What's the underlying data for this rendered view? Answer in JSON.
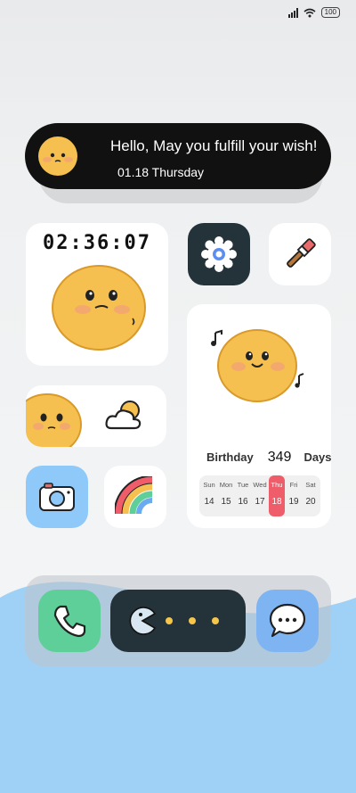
{
  "status_bar": {
    "battery": "100",
    "icons": [
      "signal-icon",
      "wifi-icon",
      "battery-icon"
    ]
  },
  "banner": {
    "greeting": "Hello, May you fulfill your wish!",
    "date": "01.18 Thursday"
  },
  "clock_widget": {
    "time": "02:36:07"
  },
  "app_icons": [
    "settings-icon",
    "paintbrush-icon",
    "camera-icon",
    "rainbow-icon",
    "cloud-sun-icon"
  ],
  "birthday_widget": {
    "label": "Birthday",
    "count": "349",
    "unit": "Days",
    "week": [
      {
        "day": "Sun",
        "date": "14"
      },
      {
        "day": "Mon",
        "date": "15"
      },
      {
        "day": "Tue",
        "date": "16"
      },
      {
        "day": "Wed",
        "date": "17"
      },
      {
        "day": "Thu",
        "date": "18"
      },
      {
        "day": "Fri",
        "date": "19"
      },
      {
        "day": "Sat",
        "date": "20"
      }
    ],
    "today_index": 4
  },
  "dock": {
    "apps": [
      "phone-icon",
      "pacman-widget",
      "message-icon"
    ]
  },
  "colors": {
    "accent_red": "#ef5d6a",
    "dock_phone": "#5fcf9a",
    "dock_message": "#7fb4f3",
    "camera_bg": "#8ec9f9",
    "settings_bg": "#24323a",
    "face_yellow": "#f5c04f",
    "wave_blue": "#9fd0f6"
  }
}
